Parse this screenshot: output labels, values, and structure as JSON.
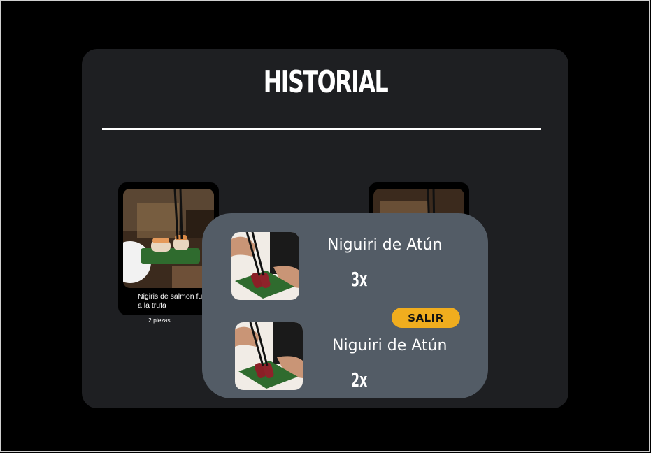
{
  "page": {
    "title": "HISTORIAL"
  },
  "history": [
    {
      "name": "Nigiris de salmon fume a la trufa",
      "pieces": "2 piezas"
    }
  ],
  "order_modal": {
    "items": [
      {
        "name": "Niguiri de Atún",
        "qty": "3x"
      },
      {
        "name": "Niguiri de Atún",
        "qty": "2x"
      }
    ],
    "exit_label": "SALIR"
  },
  "colors": {
    "background": "#000000",
    "panel": "#1e1f22",
    "modal": "#535c66",
    "accent": "#f0ad1e"
  }
}
